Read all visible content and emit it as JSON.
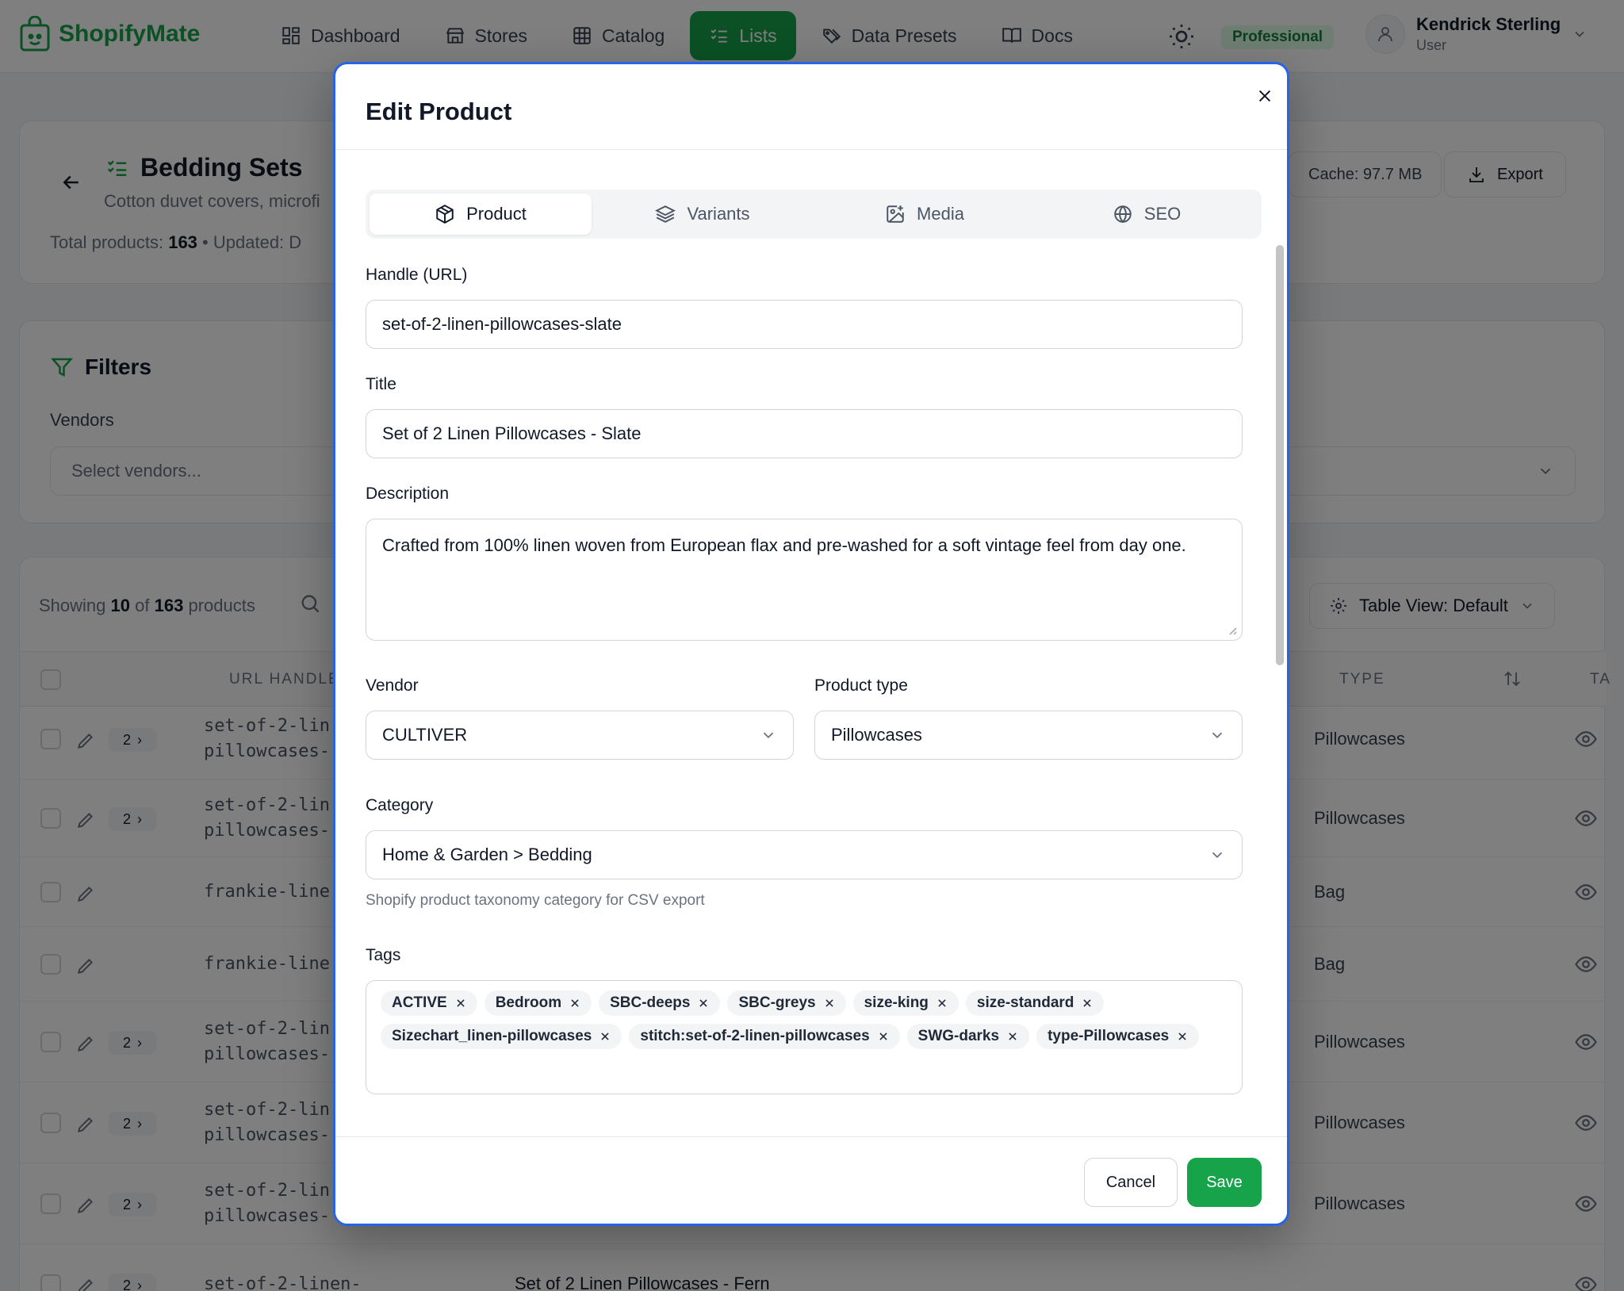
{
  "app": {
    "logo_text": "ShopifyMate",
    "nav": [
      {
        "label": "Dashboard",
        "icon": "grid-icon"
      },
      {
        "label": "Stores",
        "icon": "store-icon"
      },
      {
        "label": "Catalog",
        "icon": "table-icon"
      },
      {
        "label": "Lists",
        "icon": "checklist-icon",
        "active": true
      },
      {
        "label": "Data Presets",
        "icon": "tags-icon"
      },
      {
        "label": "Docs",
        "icon": "book-icon"
      }
    ],
    "plan": "Professional",
    "user": {
      "name": "Kendrick Sterling",
      "role": "User"
    }
  },
  "list": {
    "title": "Bedding Sets",
    "subtitle": "Cotton duvet covers, microfi",
    "total_label": "Total products:",
    "total": "163",
    "updated_label": "Updated: D",
    "cache": "Cache: 97.7 MB",
    "export": "Export"
  },
  "filters": {
    "title": "Filters",
    "vendors_label": "Vendors",
    "vendors_placeholder": "Select vendors..."
  },
  "table": {
    "showing_prefix": "Showing",
    "showing_count": "10",
    "showing_of": "of",
    "showing_total": "163",
    "showing_suffix": "products",
    "view": "Table View: Default",
    "col_handle": "URL HANDLE",
    "col_type": "TYPE",
    "col_ta": "TA",
    "rows": [
      {
        "handle": "set-of-2-lin\npillowcases-",
        "type": "Pillowcases",
        "variants": "2"
      },
      {
        "handle": "set-of-2-lin\npillowcases-",
        "type": "Pillowcases",
        "variants": "2"
      },
      {
        "handle": "frankie-line",
        "type": "Bag",
        "variants": ""
      },
      {
        "handle": "frankie-line",
        "type": "Bag",
        "variants": ""
      },
      {
        "handle": "set-of-2-lin\npillowcases-",
        "type": "Pillowcases",
        "variants": "2"
      },
      {
        "handle": "set-of-2-lin\npillowcases-",
        "type": "Pillowcases",
        "variants": "2"
      },
      {
        "handle": "set-of-2-lin\npillowcases-",
        "type": "Pillowcases",
        "variants": "2"
      },
      {
        "handle": "set-of-2-linen-",
        "type": "",
        "variants": "2",
        "title": "Set of 2 Linen Pillowcases - Fern"
      }
    ]
  },
  "modal": {
    "title": "Edit Product",
    "tabs": [
      {
        "label": "Product",
        "icon": "box-icon"
      },
      {
        "label": "Variants",
        "icon": "layers-icon"
      },
      {
        "label": "Media",
        "icon": "image-plus-icon"
      },
      {
        "label": "SEO",
        "icon": "globe-icon"
      }
    ],
    "handle_label": "Handle (URL)",
    "handle_value": "set-of-2-linen-pillowcases-slate",
    "title_label": "Title",
    "title_value": "Set of 2 Linen Pillowcases - Slate",
    "description_label": "Description",
    "description_value": "Crafted from 100% linen woven from European flax and pre-washed for a soft vintage feel from day one.",
    "vendor_label": "Vendor",
    "vendor_value": "CULTIVER",
    "product_type_label": "Product type",
    "product_type_value": "Pillowcases",
    "category_label": "Category",
    "category_value": "Home & Garden > Bedding",
    "category_helper": "Shopify product taxonomy category for CSV export",
    "tags_label": "Tags",
    "tags": [
      "ACTIVE",
      "Bedroom",
      "SBC-deeps",
      "SBC-greys",
      "size-king",
      "size-standard",
      "Sizechart_linen-pillowcases",
      "stitch:set-of-2-linen-pillowcases",
      "SWG-darks",
      "type-Pillowcases"
    ],
    "cancel": "Cancel",
    "save": "Save"
  },
  "colors": {
    "accent": "#16a34a",
    "focus": "#2563eb"
  }
}
